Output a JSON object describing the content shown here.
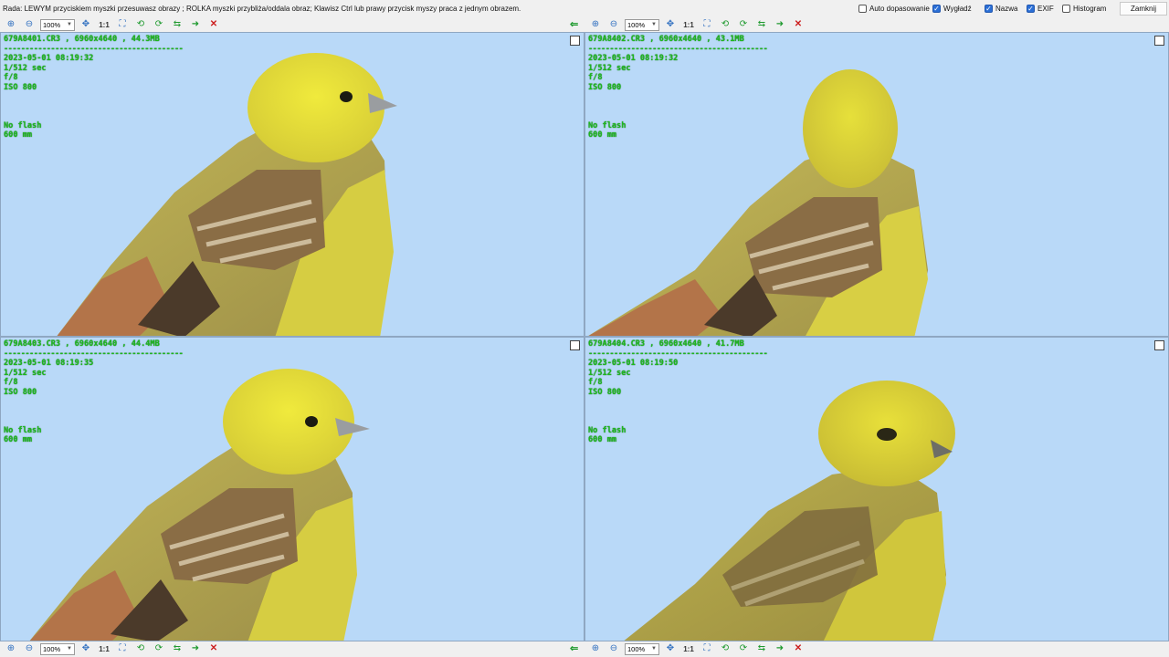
{
  "hint_text": "Rada: LEWYM przyciskiem myszki przesuwasz obrazy ; ROLKA myszki przybliża/oddala obraz; Klawisz Ctrl lub prawy przycisk myszy praca z jednym obrazem.",
  "options": {
    "auto_fit": {
      "label": "Auto dopasowanie",
      "checked": false
    },
    "smooth": {
      "label": "Wygładź",
      "checked": true
    },
    "name": {
      "label": "Nazwa",
      "checked": true
    },
    "exif": {
      "label": "EXIF",
      "checked": true
    },
    "histogram": {
      "label": "Histogram",
      "checked": false
    }
  },
  "close_label": "Zamknij",
  "toolbar": {
    "zoom_value": "100%",
    "one_to_one": "1:1",
    "icons": [
      "zoom-in-icon",
      "zoom-out-icon",
      "move-icon",
      "fit-icon",
      "rotate-left-icon",
      "rotate-right-icon",
      "flip-icon",
      "next-icon",
      "delete-icon"
    ]
  },
  "separator": "------------------------------------------",
  "images": [
    {
      "filename": "679A8401.CR3",
      "dimensions": "6960x4640",
      "size": "44.3MB",
      "date": "2023-05-01 08:19:32",
      "shutter": "1/512 sec",
      "aperture": "f/8",
      "iso": "ISO 800",
      "flash": "No flash",
      "focal": "600 mm"
    },
    {
      "filename": "679A8402.CR3",
      "dimensions": "6960x4640",
      "size": "43.1MB",
      "date": "2023-05-01 08:19:32",
      "shutter": "1/512 sec",
      "aperture": "f/8",
      "iso": "ISO 800",
      "flash": "No flash",
      "focal": "600 mm"
    },
    {
      "filename": "679A8403.CR3",
      "dimensions": "6960x4640",
      "size": "44.4MB",
      "date": "2023-05-01 08:19:35",
      "shutter": "1/512 sec",
      "aperture": "f/8",
      "iso": "ISO 800",
      "flash": "No flash",
      "focal": "600 mm"
    },
    {
      "filename": "679A8404.CR3",
      "dimensions": "6960x4640",
      "size": "41.7MB",
      "date": "2023-05-01 08:19:50",
      "shutter": "1/512 sec",
      "aperture": "f/8",
      "iso": "ISO 800",
      "flash": "No flash",
      "focal": "600 mm"
    }
  ],
  "colors": {
    "sky": "#b9d9f8",
    "bird_yellow": "#e8e040",
    "bird_olive": "#b5a84a",
    "rump_rust": "#b0704a",
    "info_green": "#1db81d"
  }
}
